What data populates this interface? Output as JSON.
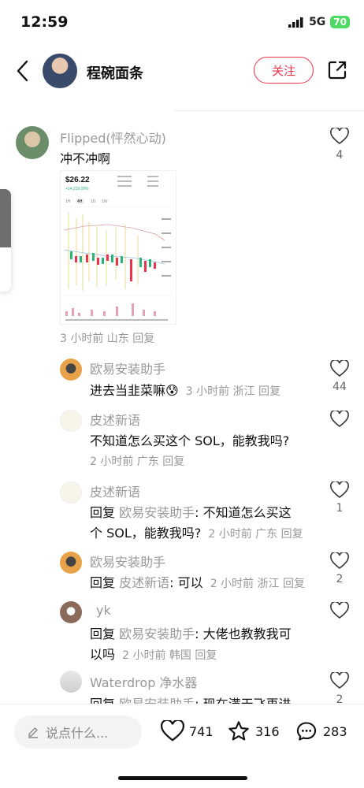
{
  "status": {
    "time": "12:59",
    "network": "5G",
    "battery": "70"
  },
  "header": {
    "user_name": "程碗面条",
    "follow_label": "关注"
  },
  "comments": [
    {
      "name": "Flipped(怦然心动)",
      "text": "冲不冲啊",
      "meta": "3 小时前 山东 回复",
      "likes": "4"
    },
    {
      "name": "欧易安装助手",
      "text": "进去当韭菜嘛😰",
      "meta": "3 小时前 浙江 回复",
      "likes": "44"
    },
    {
      "name": "皮述新语",
      "text": "不知道怎么买这个 SOL，能教我吗?",
      "meta": "2 小时前 广东 回复",
      "likes": ""
    },
    {
      "name": "皮述新语",
      "reply_prefix": "回复",
      "reply_to": "欧易安装助手",
      "text_a": ": 不知道怎么买这",
      "text_b": "个 SOL，能教我吗?",
      "meta": "2 小时前 广东 回复",
      "likes": "1"
    },
    {
      "name": "欧易安装助手",
      "reply_prefix": "回复",
      "reply_to": "皮述新语",
      "text": ": 可以",
      "meta": "2 小时前 浙江 回复",
      "likes": "2"
    },
    {
      "name": "yk",
      "reply_prefix": "回复",
      "reply_to": "欧易安装助手",
      "text_a": ": 大佬也教教我可",
      "text_b": "以吗",
      "meta": "2 小时前 韩国 回复",
      "likes": ""
    },
    {
      "name": "Waterdrop 净水器",
      "reply_prefix": "回复",
      "reply_to": "欧易安装助手",
      "text": ": 现在满天飞再进",
      "likes": "2"
    }
  ],
  "chart_image": {
    "price": "$26.22",
    "change": "+14,219.09%",
    "tabs": [
      "1H",
      "4H",
      "1D",
      "1W"
    ],
    "active_tab": "4H"
  },
  "bottom": {
    "input_placeholder": "说点什么...",
    "likes": "741",
    "favorites": "316",
    "comments": "283"
  }
}
